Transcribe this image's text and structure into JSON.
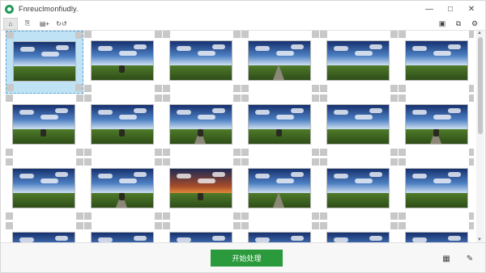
{
  "window": {
    "title": "Fnreuclmonfiudly.",
    "minimize_glyph": "—",
    "maximize_glyph": "□",
    "close_glyph": "✕"
  },
  "toolbar": {
    "items": [
      {
        "icon": "home-icon",
        "glyph": "⌂"
      },
      {
        "icon": "image-settings-icon",
        "glyph": "⎘"
      },
      {
        "icon": "add-list-icon",
        "glyph": "▤+"
      },
      {
        "icon": "rotate-icon",
        "glyph": "↻↺"
      }
    ],
    "right_items": [
      {
        "icon": "monitor-icon",
        "glyph": "▣"
      },
      {
        "icon": "copy-icon",
        "glyph": "⧉"
      },
      {
        "icon": "settings-icon",
        "glyph": "⚙"
      }
    ]
  },
  "grid": {
    "selected_index": 0,
    "tiles": [
      {
        "scene": "field-sunbeam"
      },
      {
        "scene": "field-animal"
      },
      {
        "scene": "field-windmill"
      },
      {
        "scene": "road-horizon"
      },
      {
        "scene": "field-trees"
      },
      {
        "scene": "field-clouds"
      },
      {
        "scene": "field-animal"
      },
      {
        "scene": "field-animal"
      },
      {
        "scene": "road-car"
      },
      {
        "scene": "field-person"
      },
      {
        "scene": "field-clouds"
      },
      {
        "scene": "road-car"
      },
      {
        "scene": "field-sunbeam"
      },
      {
        "scene": "road-person"
      },
      {
        "scene": "sunset-person"
      },
      {
        "scene": "hill-road"
      },
      {
        "scene": "field-trees"
      },
      {
        "scene": "field-windmill"
      },
      {
        "scene": "field-clouds"
      },
      {
        "scene": "field-clouds"
      },
      {
        "scene": "field-clouds"
      },
      {
        "scene": "field-clouds"
      },
      {
        "scene": "field-clouds"
      },
      {
        "scene": "field-clouds"
      }
    ]
  },
  "footer": {
    "start_label": "开始处理",
    "left_icon": "calendar-icon",
    "right_icon": "brush-icon",
    "left_glyph": "▦",
    "right_glyph": "✎"
  },
  "colors": {
    "accent_green": "#2b9a3c",
    "selection_blue": "#bfe2f5"
  }
}
